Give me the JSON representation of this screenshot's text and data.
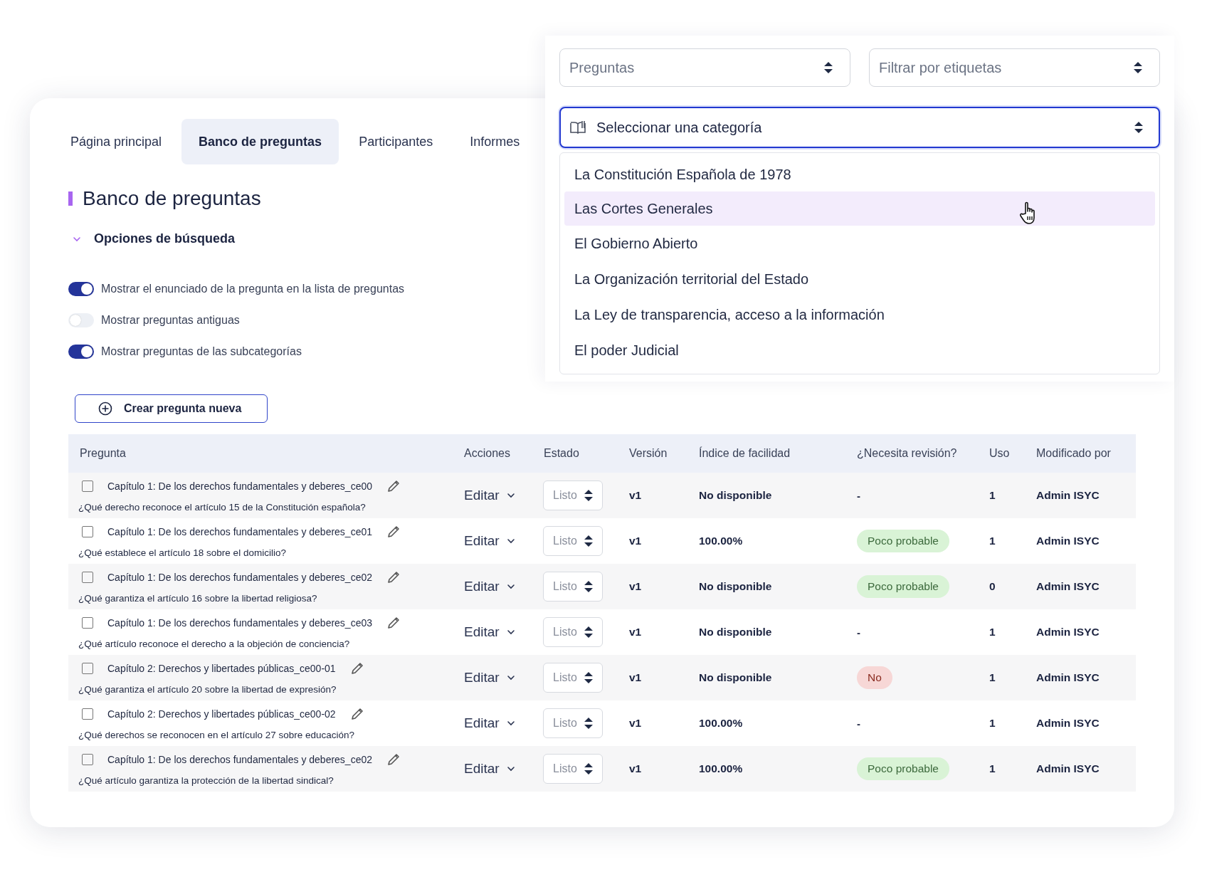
{
  "tabs": [
    {
      "label": "Página principal",
      "selected": false
    },
    {
      "label": "Banco de preguntas",
      "selected": true
    },
    {
      "label": "Participantes",
      "selected": false
    },
    {
      "label": "Informes",
      "selected": false
    }
  ],
  "heading": "Banco de preguntas",
  "search_options": {
    "title": "Opciones de búsqueda",
    "expanded": true
  },
  "toggles": [
    {
      "label": "Mostrar el enunciado de la pregunta en la lista de preguntas",
      "on": true
    },
    {
      "label": "Mostrar preguntas antiguas",
      "on": false
    },
    {
      "label": "Mostrar preguntas de las subcategorías",
      "on": true
    }
  ],
  "create_button": "Crear pregunta nueva",
  "table": {
    "columns": [
      "Pregunta",
      "Acciones",
      "Estado",
      "Versión",
      "Índice de facilidad",
      "¿Necesita revisión?",
      "Uso",
      "Modificado por"
    ],
    "rows": [
      {
        "checked": false,
        "title": "Capítulo 1: De los derechos fundamentales y deberes_ce00",
        "question": "¿Qué derecho reconoce el artículo 15 de la Constitución española?",
        "action": "Editar",
        "status": "Listo",
        "version": "v1",
        "facility": "No disponible",
        "review": {
          "kind": "none",
          "text": "-"
        },
        "usage": "1",
        "modified_by": "Admin ISYC"
      },
      {
        "checked": false,
        "title": "Capítulo 1: De los derechos fundamentales y deberes_ce01",
        "question": "¿Qué establece el artículo 18 sobre el domicilio?",
        "action": "Editar",
        "status": "Listo",
        "version": "v1",
        "facility": "100.00%",
        "review": {
          "kind": "likely",
          "text": "Poco probable"
        },
        "usage": "1",
        "modified_by": "Admin ISYC"
      },
      {
        "checked": false,
        "title": "Capítulo 1: De los derechos fundamentales y deberes_ce02",
        "question": "¿Qué garantiza el artículo 16 sobre la libertad religiosa?",
        "action": "Editar",
        "status": "Listo",
        "version": "v1",
        "facility": "No disponible",
        "review": {
          "kind": "likely",
          "text": "Poco probable"
        },
        "usage": "0",
        "modified_by": "Admin ISYC"
      },
      {
        "checked": false,
        "title": "Capítulo 1: De los derechos fundamentales y deberes_ce03",
        "question": "¿Qué artículo reconoce el derecho a la objeción de conciencia?",
        "action": "Editar",
        "status": "Listo",
        "version": "v1",
        "facility": "No disponible",
        "review": {
          "kind": "none",
          "text": "-"
        },
        "usage": "1",
        "modified_by": "Admin ISYC"
      },
      {
        "checked": false,
        "title": "Capítulo 2: Derechos y libertades públicas_ce00-01",
        "question": "¿Qué garantiza el artículo 20 sobre la libertad de expresión?",
        "action": "Editar",
        "status": "Listo",
        "version": "v1",
        "facility": "No disponible",
        "review": {
          "kind": "no",
          "text": "No"
        },
        "usage": "1",
        "modified_by": "Admin ISYC"
      },
      {
        "checked": false,
        "title": "Capítulo 2: Derechos y libertades públicas_ce00-02",
        "question": "¿Qué derechos se reconocen en el artículo 27 sobre educación?",
        "action": "Editar",
        "status": "Listo",
        "version": "v1",
        "facility": "100.00%",
        "review": {
          "kind": "none",
          "text": "-"
        },
        "usage": "1",
        "modified_by": "Admin ISYC"
      },
      {
        "checked": false,
        "title": "Capítulo 1: De los derechos fundamentales y deberes_ce02",
        "question": "¿Qué artículo garantiza la protección de la libertad sindical?",
        "action": "Editar",
        "status": "Listo",
        "version": "v1",
        "facility": "100.00%",
        "review": {
          "kind": "likely",
          "text": "Poco probable"
        },
        "usage": "1",
        "modified_by": "Admin ISYC"
      }
    ]
  },
  "filters": {
    "type_select": "Preguntas",
    "tags_select": "Filtrar por etiquetas"
  },
  "category_select": {
    "placeholder": "Seleccionar una categoría",
    "expanded": true,
    "options": [
      {
        "label": "La Constitución Española de 1978",
        "selected": false
      },
      {
        "label": "Las Cortes Generales",
        "selected": true
      },
      {
        "label": "El Gobierno Abierto",
        "selected": false
      },
      {
        "label": "La Organización territorial del Estado",
        "selected": false
      },
      {
        "label": "La Ley de transparencia, acceso a la información",
        "selected": false
      },
      {
        "label": "El poder Judicial",
        "selected": false
      }
    ]
  }
}
